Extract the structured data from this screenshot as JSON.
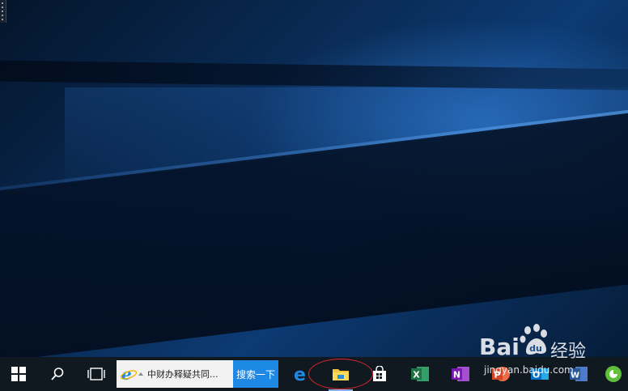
{
  "desktop": {
    "wallpaper": "windows-10-hero"
  },
  "taskbar": {
    "start": {
      "icon": "windows-logo-icon"
    },
    "search": {
      "icon": "search-icon"
    },
    "task_view": {
      "icon": "task-view-icon"
    },
    "search_box": {
      "text": "中财办释疑共同...",
      "button_label": "搜索一下",
      "icon": "ie-icon"
    },
    "pinned": [
      {
        "name": "edge",
        "icon": "edge-icon"
      },
      {
        "name": "file-explorer",
        "icon": "folder-icon",
        "highlighted": true
      },
      {
        "name": "store",
        "icon": "store-icon"
      },
      {
        "name": "excel",
        "icon": "excel-icon",
        "letter": "X"
      },
      {
        "name": "onenote",
        "icon": "onenote-icon",
        "letter": "N"
      },
      {
        "name": "powerpoint",
        "icon": "powerpoint-icon",
        "letter": "P"
      },
      {
        "name": "outlook",
        "icon": "outlook-icon",
        "letter": "O"
      },
      {
        "name": "word",
        "icon": "word-icon",
        "letter": "W"
      },
      {
        "name": "sogou-browser",
        "icon": "browser-icon"
      }
    ]
  },
  "watermark": {
    "brand": "Bai",
    "brand_cn": "经验",
    "url": "jingyan.baidu.com"
  },
  "colors": {
    "taskbar": "#101820",
    "search_button": "#1e88e5",
    "highlight": "#e0262e",
    "excel": "#1f7244",
    "onenote": "#7719aa",
    "powerpoint": "#d24726",
    "outlook": "#0072c6",
    "word": "#2b5797"
  }
}
